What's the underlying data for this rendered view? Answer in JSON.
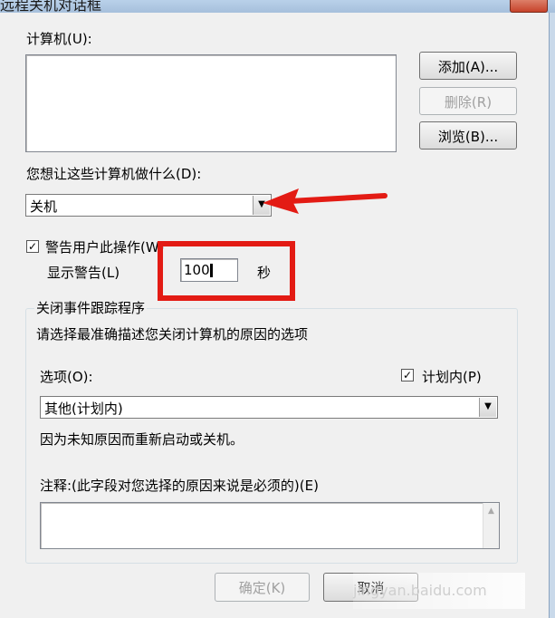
{
  "window": {
    "title": "远程关机对话框"
  },
  "computers": {
    "label": "计算机(U):",
    "add_button": "添加(A)...",
    "delete_button": "删除(R)",
    "browse_button": "浏览(B)..."
  },
  "action": {
    "label": "您想让这些计算机做什么(D):",
    "selected": "关机"
  },
  "warning": {
    "checkbox_label": "警告用户此操作(W)",
    "checked": true,
    "display_label": "显示警告(L)",
    "seconds_value": "100",
    "seconds_unit": "秒"
  },
  "tracker": {
    "group_title": "关闭事件跟踪程序",
    "instruction": "请选择最准确描述您关闭计算机的原因的选项",
    "option_label": "选项(O):",
    "planned_label": "计划内(P)",
    "planned_checked": true,
    "option_selected": "其他(计划内)",
    "description": "因为未知原因而重新启动或关机。",
    "comment_label": "注释:(此字段对您选择的原因来说是必须的)(E)"
  },
  "footer": {
    "ok_button": "确定(K)",
    "cancel_button": "取消"
  },
  "overlay": {
    "watermark_text": "jingyan.baidu.com"
  },
  "colors": {
    "annotation_red": "#e31b14",
    "dialog_bg": "#f0f0f0"
  },
  "icons": {
    "dropdown_arrow": "chevron-down-icon",
    "check": "checkmark-icon"
  }
}
